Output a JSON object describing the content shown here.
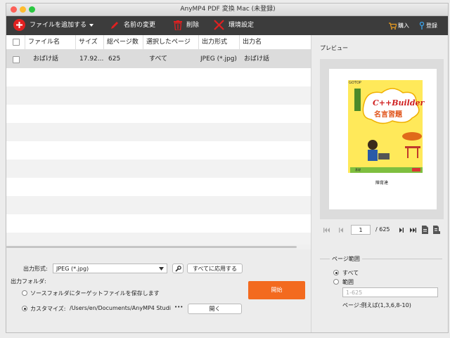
{
  "window": {
    "title": "AnyMP4 PDF 変換 Mac (未登録)"
  },
  "toolbar": {
    "add_file": "ファイルを追加する",
    "rename": "名前の変更",
    "delete": "削除",
    "settings": "環境設定",
    "buy": "購入",
    "register": "登録"
  },
  "table": {
    "headers": [
      "ファイル名",
      "サイズ",
      "総ページ数",
      "選択したページ",
      "出力形式",
      "出力名"
    ],
    "rows": [
      {
        "name": "おばけ話",
        "size": "17.92...",
        "pages": "625",
        "selected": "すべて",
        "format": "JPEG (*.jpg)",
        "output": "おばけ話"
      }
    ]
  },
  "output": {
    "format_label": "出力形式:",
    "format_value": "JPEG (*.jpg)",
    "apply_all": "すべてに応用する",
    "folder_label": "出力フォルダ:",
    "source_option": "ソースフォルダにターゲットファイルを保存します",
    "custom_option": "カスタマイズ:",
    "custom_path": "/Users/en/Documents/AnyMP4 Studi",
    "more": "•••",
    "open": "開く",
    "start": "開始"
  },
  "preview": {
    "title": "プレビュー",
    "current_page": "1",
    "total_pages": "/ 625",
    "cover": {
      "publisher": "GOTOP",
      "title": "C++Builder",
      "subtitle": "名言習題",
      "author": "陳育達",
      "small": "基礎"
    }
  },
  "page_range": {
    "legend": "ページ範囲",
    "all": "すべて",
    "range": "範囲",
    "range_placeholder": "1-625",
    "example": "ページ:例えば(1,3,6,8-10)"
  },
  "colors": {
    "toolbar": "#3c3c3c",
    "accent": "#e02020",
    "start_button": "#f36a1f",
    "selected_row": "#dcdcdc",
    "stripe_row": "#f2f2f2"
  }
}
